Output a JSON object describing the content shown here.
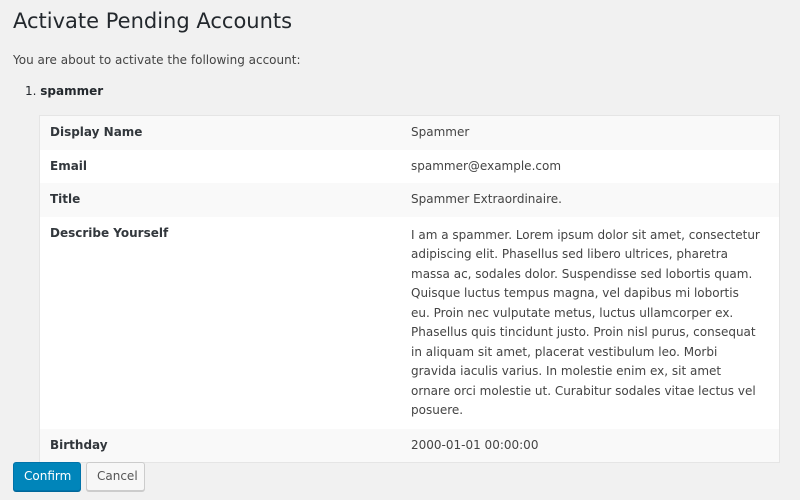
{
  "page": {
    "title": "Activate Pending Accounts",
    "intro": "You are about to activate the following account:"
  },
  "account": {
    "number": "1.",
    "username": "spammer"
  },
  "details": [
    {
      "label": "Display Name",
      "value": "Spammer"
    },
    {
      "label": "Email",
      "value": "spammer@example.com"
    },
    {
      "label": "Title",
      "value": "Spammer Extraordinaire."
    },
    {
      "label": "Describe Yourself",
      "value": "I am a spammer. Lorem ipsum dolor sit amet, consectetur adipiscing elit. Phasellus sed libero ultrices, pharetra massa ac, sodales dolor. Suspendisse sed lobortis quam. Quisque luctus tempus magna, vel dapibus mi lobortis eu. Proin nec vulputate metus, luctus ullamcorper ex. Phasellus quis tincidunt justo. Proin nisl purus, consequat in aliquam sit amet, placerat vestibulum leo. Morbi gravida iaculis varius. In molestie enim ex, sit amet ornare orci molestie ut. Curabitur sodales vitae lectus vel posuere."
    },
    {
      "label": "Birthday",
      "value": "2000-01-01 00:00:00"
    }
  ],
  "actions": {
    "confirm_label": "Confirm",
    "cancel_label": "Cancel"
  },
  "colors": {
    "primary": "#0085ba",
    "background": "#f1f1f1"
  }
}
